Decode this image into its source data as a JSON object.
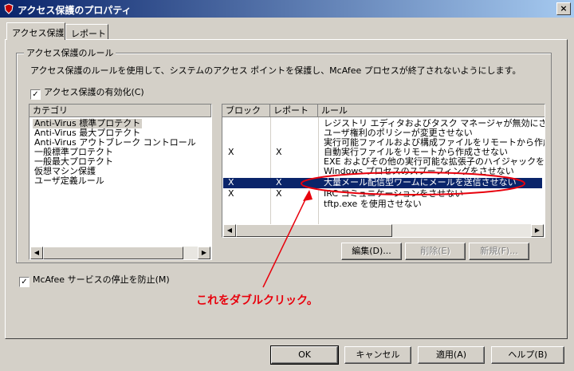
{
  "window": {
    "title": "アクセス保護のプロパティ",
    "close_glyph": "×"
  },
  "tabs": [
    {
      "label": "アクセス保護",
      "active": true
    },
    {
      "label": "レポート",
      "active": false
    }
  ],
  "group": {
    "label": "アクセス保護のルール",
    "description": "アクセス保護のルールを使用して、システムのアクセス ポイントを保護し、McAfee プロセスが終了されないようにします。",
    "enable_label": "アクセス保護の有効化(C)",
    "enable_checked": true
  },
  "categories": {
    "header": "カテゴリ",
    "items": [
      "Anti-Virus 標準プロテクト",
      "Anti-Virus 最大プロテクト",
      "Anti-Virus アウトブレーク コントロール",
      "一般標準プロテクト",
      "一般最大プロテクト",
      "仮想マシン保護",
      "ユーザ定義ルール"
    ],
    "selected_index": 0
  },
  "rules": {
    "headers": {
      "block": "ブロック",
      "report": "レポート",
      "rule": "ルール"
    },
    "rows": [
      {
        "block": "",
        "report": "",
        "rule": "レジストリ エディタおよびタスク マネージャが無効にさせない"
      },
      {
        "block": "",
        "report": "",
        "rule": "ユーザ権利のポリシーが変更させない"
      },
      {
        "block": "",
        "report": "",
        "rule": "実行可能ファイルおよび構成ファイルをリモートから作成または"
      },
      {
        "block": "X",
        "report": "X",
        "rule": "自動実行ファイルをリモートから作成させない"
      },
      {
        "block": "",
        "report": "",
        "rule": "EXE およびその他の実行可能な拡張子のハイジャックを防止"
      },
      {
        "block": "",
        "report": "",
        "rule": "Windows プロセスのスプーフィングをさせない"
      },
      {
        "block": "X",
        "report": "X",
        "rule": "大量メール配信型ワームにメールを送信させない"
      },
      {
        "block": "X",
        "report": "X",
        "rule": "IRC コミュニケーションをさせない"
      },
      {
        "block": "",
        "report": "",
        "rule": "tftp.exe を使用させない"
      }
    ],
    "selected_index": 6
  },
  "rule_buttons": {
    "edit": "編集(D)...",
    "delete": "削除(E)",
    "new": "新規(F)..."
  },
  "stop_service": {
    "label": "McAfee サービスの停止を防止(M)",
    "checked": true
  },
  "annotation": {
    "text": "これをダブルクリック。",
    "color": "#e8000c"
  },
  "footer": {
    "ok": "OK",
    "cancel": "キャンセル",
    "apply": "適用(A)",
    "help": "ヘルプ(B)"
  },
  "icons": {
    "check": "✓",
    "left": "◀",
    "right": "▶"
  }
}
